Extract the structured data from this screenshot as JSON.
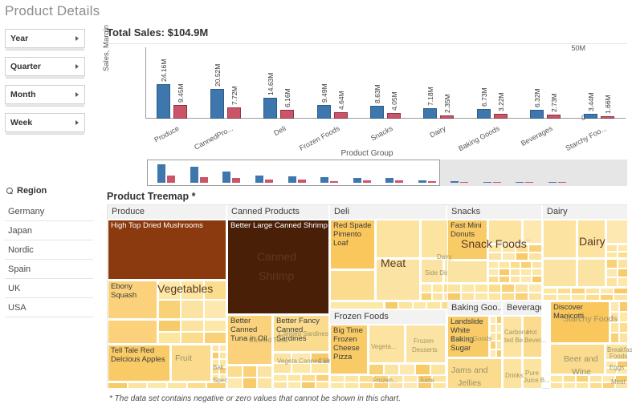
{
  "page": {
    "title": "Product Details"
  },
  "sidebar": {
    "filters": [
      {
        "label": "Year",
        "icon": "chevron-right-icon"
      },
      {
        "label": "Quarter",
        "icon": "chevron-right-icon"
      },
      {
        "label": "Month",
        "icon": "chevron-right-icon"
      },
      {
        "label": "Week",
        "icon": "chevron-right-icon"
      }
    ],
    "region": {
      "icon": "search-icon",
      "title": "Region",
      "items": [
        "Germany",
        "Japan",
        "Nordic",
        "Spain",
        "UK",
        "USA"
      ]
    }
  },
  "chart_data": {
    "type": "bar",
    "title": "Total Sales: $104.9M",
    "xlabel": "Product Group",
    "ylabel": "Sales, Margin",
    "ylim": [
      0,
      50000000
    ],
    "ytick_labels": [
      "50M",
      "0"
    ],
    "grid": false,
    "legend": "none",
    "categories": [
      "Produce",
      "CannedPro...",
      "Deli",
      "Frozen Foods",
      "Snacks",
      "Dairy",
      "Baking Goods",
      "Beverages",
      "Starchy Foo..."
    ],
    "series": [
      {
        "name": "Sales",
        "color": "#3d77ad",
        "values": [
          24.16,
          20.52,
          14.63,
          9.49,
          8.63,
          7.18,
          6.73,
          6.32,
          3.44
        ],
        "labels": [
          "24.16M",
          "20.52M",
          "14.63M",
          "9.49M",
          "8.63M",
          "7.18M",
          "6.73M",
          "6.32M",
          "3.44M"
        ]
      },
      {
        "name": "Margin",
        "color": "#cb5568",
        "values": [
          9.45,
          7.72,
          6.16,
          4.64,
          4.05,
          2.35,
          3.22,
          2.73,
          1.66
        ],
        "labels": [
          "9.45M",
          "7.72M",
          "6.16M",
          "4.64M",
          "4.05M",
          "2.35M",
          "3.22M",
          "2.73M",
          "1.66M"
        ]
      }
    ]
  },
  "treemap": {
    "title": "Product Treemap *",
    "footnote": "* The data set contains negative or zero values that cannot be shown in this chart.",
    "headers": [
      {
        "label": "Produce"
      },
      {
        "label": "Canned Products"
      },
      {
        "label": "Deli"
      },
      {
        "label": "Snacks"
      },
      {
        "label": "Dairy"
      },
      {
        "label": "Frozen Foods"
      },
      {
        "label": "Baking Goo..."
      },
      {
        "label": "Beverages"
      }
    ],
    "group_labels": [
      "Vegetables",
      "Canned Shrimp",
      "Meat",
      "Fruit",
      "Snack Foods",
      "Dairy",
      "Baking Goods",
      "Starchy Foods",
      "Frozen Desserts",
      "Jams and Jellies",
      "Beer and Wine",
      "Drinks",
      "Side Dishes",
      "Vegeta...",
      "Canned Tuna",
      "Canned Sardines",
      "Breakfast Foods",
      "Carbonated Be...",
      "Hot Bever...",
      "Pure Juice B...",
      "Juice"
    ],
    "cells": [
      "High Top Dried Mushrooms",
      "Better Large Canned Shrimp",
      "Red Spade Pimento Loaf",
      "Ebony Squash",
      "Tell Tale Red Delcious Apples",
      "Better Canned Tuna in Oil",
      "Better Fancy Canned Sardines",
      "Big Time Frozen Cheese Pizza",
      "Fast Mini Donuts",
      "Landslide White Baking Sugar",
      "Discover Manicotti"
    ]
  }
}
